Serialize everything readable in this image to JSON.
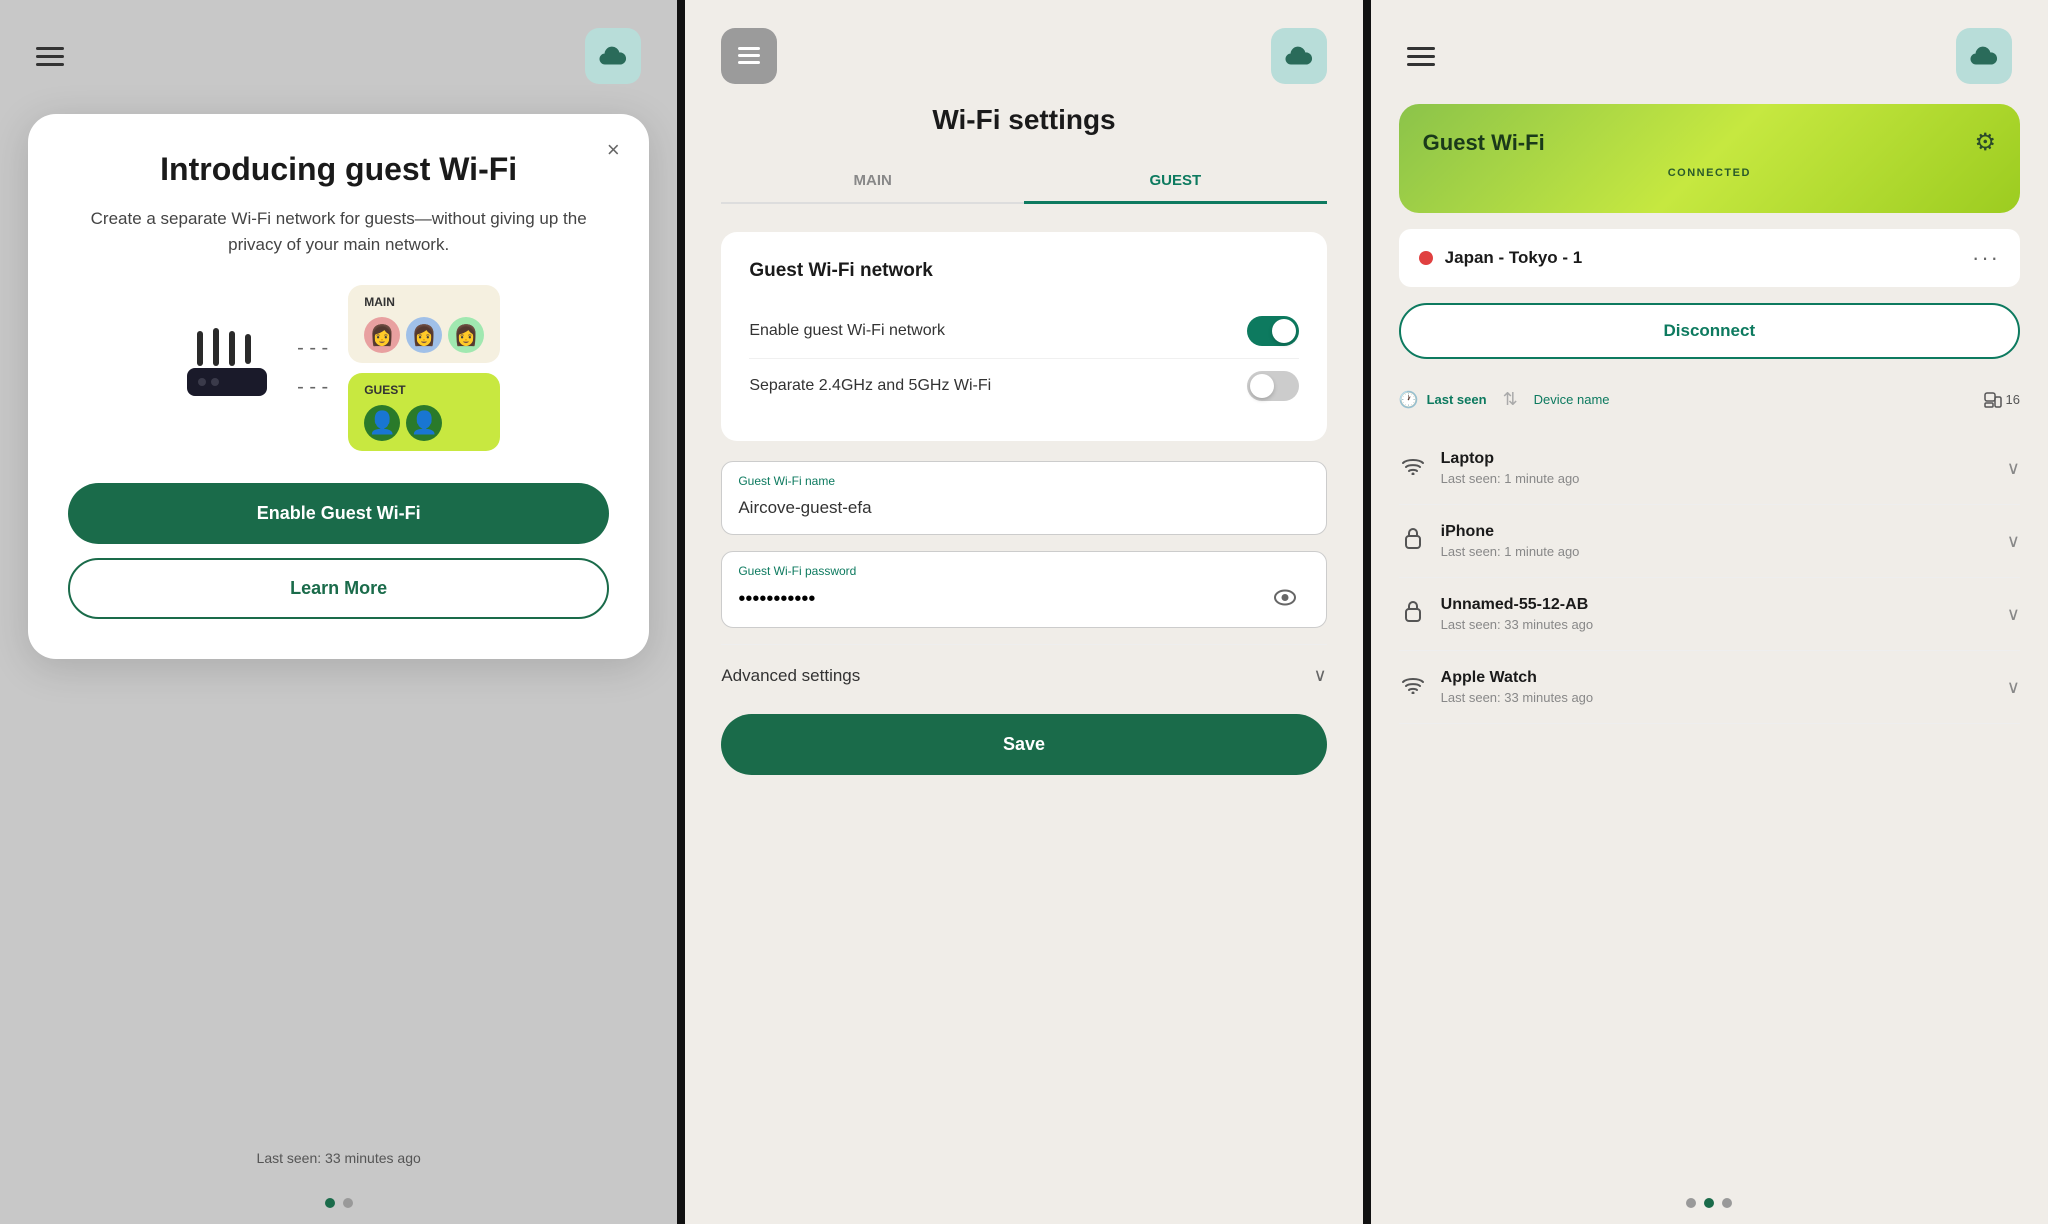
{
  "colors": {
    "accent": "#0d7a5f",
    "primary_btn": "#1a6b4a",
    "lime": "#c6e840",
    "cloud_bg": "#b8ddd9"
  },
  "panel1": {
    "modal": {
      "title": "Introducing guest Wi-Fi",
      "description": "Create a separate Wi-Fi network for guests—without giving up the privacy of your main network.",
      "main_label": "MAIN",
      "guest_label": "GUEST",
      "enable_btn": "Enable Guest Wi-Fi",
      "learn_more_btn": "Learn More"
    },
    "footer_text": "Last seen: 33 minutes ago",
    "dots": [
      true,
      false
    ]
  },
  "panel2": {
    "page_title": "Wi-Fi settings",
    "tabs": [
      {
        "label": "MAIN",
        "active": false
      },
      {
        "label": "GUEST",
        "active": true
      }
    ],
    "card_title": "Guest Wi-Fi network",
    "settings": [
      {
        "label": "Enable guest Wi-Fi network",
        "enabled": true
      },
      {
        "label": "Separate 2.4GHz and 5GHz Wi-Fi",
        "enabled": false
      }
    ],
    "wifi_name_label": "Guest Wi-Fi name",
    "wifi_name_value": "Aircove-guest-efa",
    "wifi_password_label": "Guest Wi-Fi password",
    "wifi_password_value": "••••••••",
    "advanced_label": "Advanced settings",
    "save_btn": "Save"
  },
  "panel3": {
    "card_title": "Guest Wi-Fi",
    "connected_label": "CONNECTED",
    "location": "Japan - Tokyo - 1",
    "disconnect_btn": "Disconnect",
    "sort": {
      "last_seen": "Last seen",
      "device_name": "Device name",
      "count": 16
    },
    "devices": [
      {
        "name": "Laptop",
        "last_seen": "Last seen: 1 minute ago",
        "icon": "wifi"
      },
      {
        "name": "iPhone",
        "last_seen": "Last seen: 1 minute ago",
        "icon": "lock"
      },
      {
        "name": "Unnamed-55-12-AB",
        "last_seen": "Last seen: 33 minutes ago",
        "icon": "lock"
      },
      {
        "name": "Apple Watch",
        "last_seen": "Last seen: 33 minutes ago",
        "icon": "wifi"
      }
    ],
    "dots": [
      false,
      true,
      false
    ]
  }
}
